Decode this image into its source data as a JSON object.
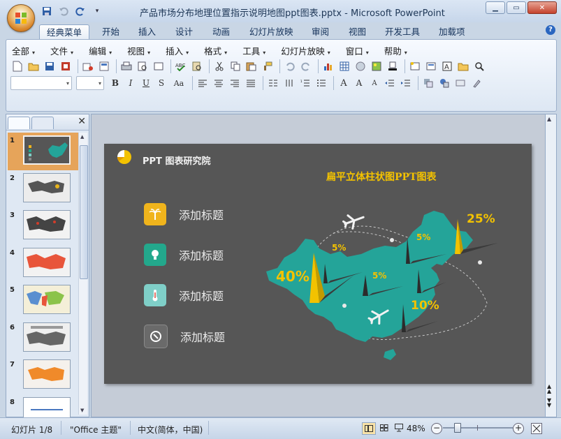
{
  "window": {
    "title": "产品市场分布地理位置指示说明地图ppt图表.pptx - Microsoft PowerPoint"
  },
  "ribbon_tabs": [
    "经典菜单",
    "开始",
    "插入",
    "设计",
    "动画",
    "幻灯片放映",
    "审阅",
    "视图",
    "开发工具",
    "加载项"
  ],
  "classic_menus": [
    "全部",
    "文件",
    "编辑",
    "视图",
    "插入",
    "格式",
    "工具",
    "幻灯片放映",
    "窗口",
    "帮助"
  ],
  "slide_panel": {
    "slide_numbers": [
      "1",
      "2",
      "3",
      "4",
      "5",
      "6",
      "7",
      "8"
    ],
    "selected": "1"
  },
  "slide": {
    "brand": "PPT 图表研究院",
    "chart_title": "扁平立体柱状图PPT图表",
    "items": [
      {
        "label": "添加标题",
        "icon": "palm-tree-icon",
        "color": "#f0b41c"
      },
      {
        "label": "添加标题",
        "icon": "lightbulb-icon",
        "color": "#23a88c"
      },
      {
        "label": "添加标题",
        "icon": "thermometer-icon",
        "color": "#7fcfc8"
      },
      {
        "label": "添加标题",
        "icon": "compass-icon",
        "color": "#6a6a6a"
      }
    ],
    "percents": [
      "40%",
      "5%",
      "5%",
      "5%",
      "25%",
      "10%"
    ],
    "map_color": "#24a499",
    "accent_color": "#f3c200",
    "background_color": "#565656"
  },
  "status": {
    "slide_info": "幻灯片 1/8",
    "theme": "\"Office 主题\"",
    "language": "中文(简体，中国)",
    "zoom": "48%"
  }
}
